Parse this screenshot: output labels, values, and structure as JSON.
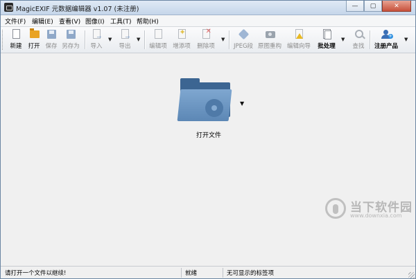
{
  "window": {
    "title": "MagicEXIF 元数据编辑器 v1.07 (未注册)",
    "controls": {
      "minimize": "—",
      "maximize": "▢",
      "close": "✕"
    }
  },
  "menu": [
    "文件(F)",
    "编辑(E)",
    "查看(V)",
    "图像(I)",
    "工具(T)",
    "帮助(H)"
  ],
  "toolbar": {
    "new": "新建",
    "open": "打开",
    "save": "保存",
    "save_as": "另存为",
    "import": "导入",
    "export": "导出",
    "edit_item": "编辑项",
    "add_item": "增添项",
    "delete_item": "删除项",
    "jpeg_segment": "JPEG段",
    "rebuild_original": "原图重构",
    "edit_wizard": "编辑向导",
    "batch": "批处理",
    "find": "查找",
    "register": "注册产品"
  },
  "main": {
    "open_file_label": "打开文件"
  },
  "watermark": {
    "brand": "当下软件园",
    "url": "www.downxia.com"
  },
  "status": {
    "hint": "请打开一个文件以继续!",
    "state": "就绪",
    "tags": "无可显示的标签项"
  }
}
